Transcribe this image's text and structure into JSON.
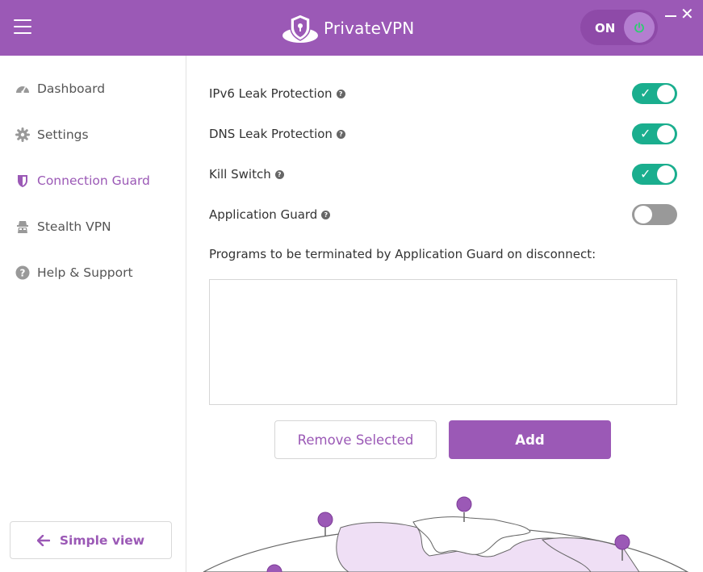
{
  "header": {
    "brand": "PrivateVPN",
    "power_status": "ON"
  },
  "sidebar": {
    "items": [
      {
        "label": "Dashboard",
        "icon": "dashboard-icon"
      },
      {
        "label": "Settings",
        "icon": "gear-icon"
      },
      {
        "label": "Connection Guard",
        "icon": "shield-icon",
        "active": true
      },
      {
        "label": "Stealth VPN",
        "icon": "stealth-icon"
      },
      {
        "label": "Help & Support",
        "icon": "question-icon"
      }
    ],
    "simple_view_label": "Simple view"
  },
  "main": {
    "options": [
      {
        "label": "IPv6 Leak Protection",
        "enabled": true
      },
      {
        "label": "DNS Leak Protection",
        "enabled": true
      },
      {
        "label": "Kill Switch",
        "enabled": true
      },
      {
        "label": "Application Guard",
        "enabled": false
      }
    ],
    "programs_label": "Programs to be terminated by Application Guard on disconnect:",
    "remove_button": "Remove Selected",
    "add_button": "Add"
  },
  "colors": {
    "accent": "#9b59b6",
    "toggle_on": "#1aae8e",
    "toggle_off": "#999999"
  }
}
